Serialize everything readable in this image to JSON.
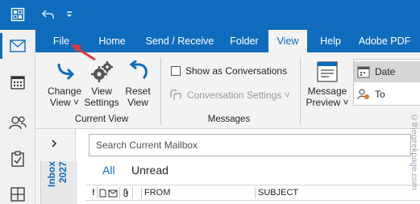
{
  "qat": {
    "app_icon": "outlook-grid-icon",
    "undo_icon": "undo-icon",
    "customize_icon": "qat-dropdown-icon"
  },
  "rail": {
    "items": [
      {
        "name": "mail",
        "icon": "mail-icon",
        "active": true
      },
      {
        "name": "calendar",
        "icon": "calendar-icon"
      },
      {
        "name": "people",
        "icon": "people-icon"
      },
      {
        "name": "tasks",
        "icon": "tasks-icon"
      },
      {
        "name": "apps",
        "icon": "apps-grid-icon"
      }
    ]
  },
  "tabs": [
    {
      "label": "File",
      "active": false
    },
    {
      "label": "Home",
      "active": false
    },
    {
      "label": "Send / Receive",
      "active": false
    },
    {
      "label": "Folder",
      "active": false
    },
    {
      "label": "View",
      "active": true
    },
    {
      "label": "Help",
      "active": false
    },
    {
      "label": "Adobe PDF",
      "active": false
    }
  ],
  "ribbon": {
    "current_view": {
      "change_view": {
        "line1": "Change",
        "line2": "View ˅"
      },
      "view_settings": {
        "line1": "View",
        "line2": "Settings"
      },
      "reset_view": {
        "line1": "Reset",
        "line2": "View"
      },
      "group_label": "Current View"
    },
    "messages": {
      "show_as_conversations": "Show as Conversations",
      "show_as_conversations_checked": false,
      "conversation_settings": "Conversation Settings ˅",
      "group_label": "Messages"
    },
    "message_preview": {
      "line1": "Message",
      "line2": "Preview ˅"
    },
    "arrangement": {
      "items": [
        {
          "label": "Date",
          "selected": true,
          "icon": "calendar-sort-icon"
        },
        {
          "label": "To",
          "selected": false,
          "icon": "person-to-icon"
        }
      ]
    }
  },
  "mail": {
    "expand_icon": "chevron-right-icon",
    "folder_label": "Inbox 2027",
    "search_placeholder": "Search Current Mailbox",
    "filters": {
      "all": "All",
      "unread": "Unread"
    },
    "columns": {
      "importance": "!",
      "icon": "document-icon",
      "flag": "envelope-icon",
      "attachment": "paperclip-icon",
      "from": "FROM",
      "subject": "SUBJECT"
    }
  },
  "watermark": "©thegeekpage.com",
  "annotation": {
    "color": "#e0393e"
  },
  "colors": {
    "accent": "#0f6cbd",
    "ribbon_bg": "#f3f3f3",
    "rail_bg": "#f0f0f0"
  }
}
